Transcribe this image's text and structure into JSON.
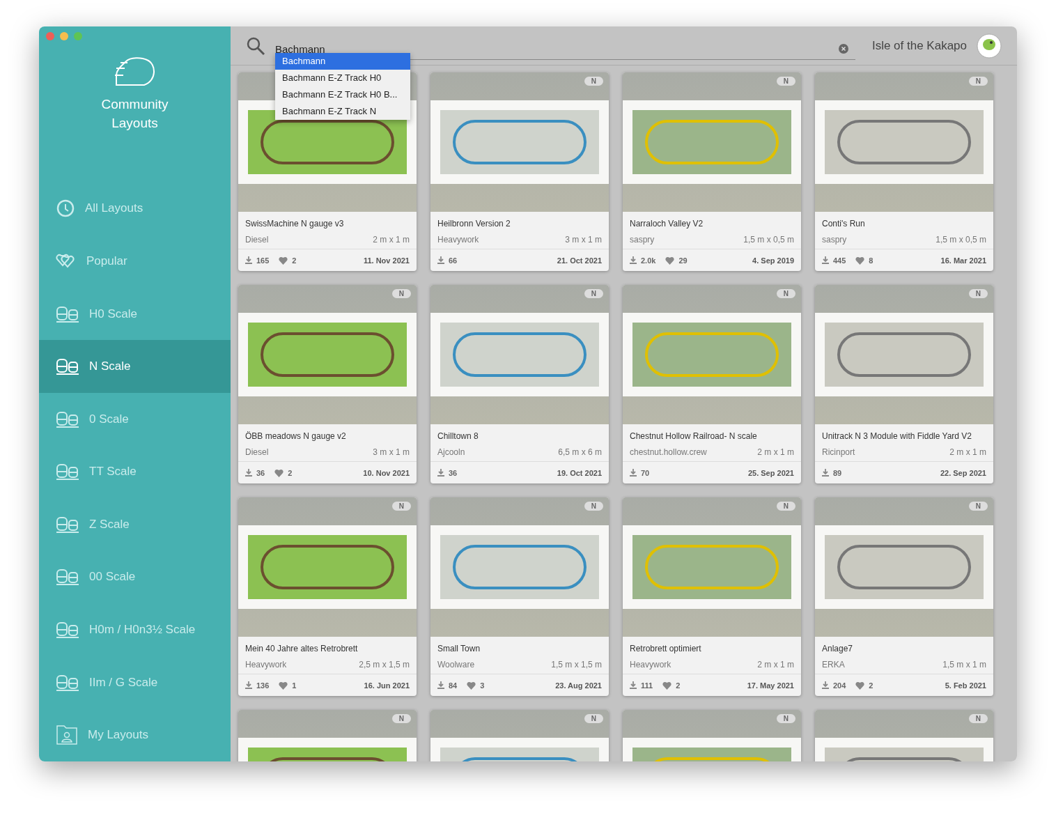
{
  "sidebar": {
    "title": "Community Layouts",
    "items": [
      {
        "label": "All Layouts",
        "kind": "clock",
        "selected": false
      },
      {
        "label": "Popular",
        "kind": "hearts",
        "selected": false
      },
      {
        "label": "H0 Scale",
        "kind": "train",
        "selected": false
      },
      {
        "label": "N Scale",
        "kind": "train",
        "selected": true
      },
      {
        "label": "0 Scale",
        "kind": "train",
        "selected": false
      },
      {
        "label": "TT Scale",
        "kind": "train",
        "selected": false
      },
      {
        "label": "Z Scale",
        "kind": "train",
        "selected": false
      },
      {
        "label": "00 Scale",
        "kind": "train",
        "selected": false
      },
      {
        "label": "H0m / H0n3½ Scale",
        "kind": "train",
        "selected": false
      },
      {
        "label": "IIm / G Scale",
        "kind": "train",
        "selected": false
      },
      {
        "label": "My Layouts",
        "kind": "folder",
        "selected": false
      }
    ]
  },
  "search": {
    "value": "Bachmann",
    "suggestions": [
      {
        "label": "Bachmann",
        "selected": true
      },
      {
        "label": "Bachmann E-Z Track H0",
        "selected": false
      },
      {
        "label": "Bachmann E-Z Track H0 B...",
        "selected": false
      },
      {
        "label": "Bachmann E-Z Track N",
        "selected": false
      }
    ]
  },
  "user": {
    "name": "Isle of the Kakapo"
  },
  "cards": [
    {
      "title": "SwissMachine N gauge v3",
      "author": "Diesel",
      "size": "2 m x 1 m",
      "downloads": "165",
      "likes": "2",
      "date": "11. Nov 2021"
    },
    {
      "badge": "N",
      "title": "Heilbronn Version 2",
      "author": "Heavywork",
      "size": "3 m x 1 m",
      "downloads": "66",
      "date": "21. Oct 2021"
    },
    {
      "badge": "N",
      "title": "Narraloch Valley V2",
      "author": "saspry",
      "size": "1,5 m x 0,5 m",
      "downloads": "2.0k",
      "likes": "29",
      "date": "4. Sep 2019"
    },
    {
      "badge": "N",
      "title": "Conti's Run",
      "author": "saspry",
      "size": "1,5 m x 0,5 m",
      "downloads": "445",
      "likes": "8",
      "date": "16. Mar 2021"
    },
    {
      "badge": "N",
      "title": "ÖBB meadows N gauge v2",
      "author": "Diesel",
      "size": "3 m x 1 m",
      "downloads": "36",
      "likes": "2",
      "date": "10. Nov 2021"
    },
    {
      "badge": "N",
      "title": "Chilltown 8",
      "author": "Ajcooln",
      "size": "6,5 m x 6 m",
      "downloads": "36",
      "date": "19. Oct 2021"
    },
    {
      "badge": "N",
      "title": "Chestnut Hollow Railroad- N scale",
      "author": "chestnut.hollow.crew",
      "size": "2 m x 1 m",
      "downloads": "70",
      "date": "25. Sep 2021"
    },
    {
      "badge": "N",
      "title": "Unitrack N 3 Module with Fiddle Yard V2",
      "author": "Ricinport",
      "size": "2 m x 1 m",
      "downloads": "89",
      "date": "22. Sep 2021"
    },
    {
      "badge": "N",
      "title": "Mein 40 Jahre altes Retrobrett",
      "author": "Heavywork",
      "size": "2,5 m x 1,5 m",
      "downloads": "136",
      "likes": "1",
      "date": "16. Jun 2021"
    },
    {
      "badge": "N",
      "title": "Small Town",
      "author": "Woolware",
      "size": "1,5 m x 1,5 m",
      "downloads": "84",
      "likes": "3",
      "date": "23. Aug 2021"
    },
    {
      "badge": "N",
      "title": "Retrobrett optimiert",
      "author": "Heavywork",
      "size": "2 m x 1 m",
      "downloads": "111",
      "likes": "2",
      "date": "17. May 2021"
    },
    {
      "badge": "N",
      "title": "Anlage7",
      "author": "ERKA",
      "size": "1,5 m x 1 m",
      "downloads": "204",
      "likes": "2",
      "date": "5. Feb 2021"
    },
    {
      "badge": "N"
    },
    {
      "badge": "N"
    },
    {
      "badge": "N"
    },
    {
      "badge": "N"
    }
  ]
}
